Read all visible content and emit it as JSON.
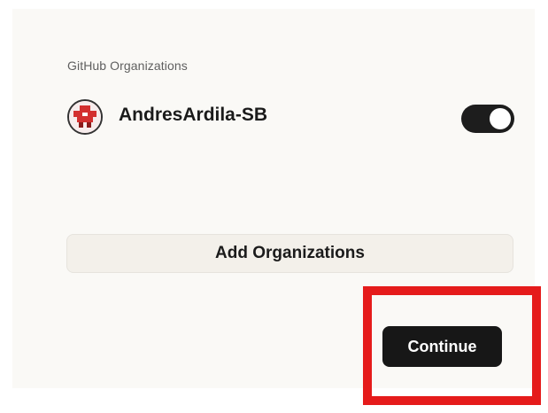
{
  "section": {
    "label": "GitHub Organizations"
  },
  "organizations": [
    {
      "name": "AndresArdila-SB",
      "enabled": true,
      "avatar_icon": "pixel-avatar-icon",
      "avatar_color": "#d32f2f"
    }
  ],
  "actions": {
    "add_organizations_label": "Add Organizations",
    "continue_label": "Continue"
  },
  "colors": {
    "highlight": "#e51b1b",
    "primary_button": "#171717",
    "toggle_on": "#1d1d1d",
    "panel_background": "#faf9f6"
  }
}
